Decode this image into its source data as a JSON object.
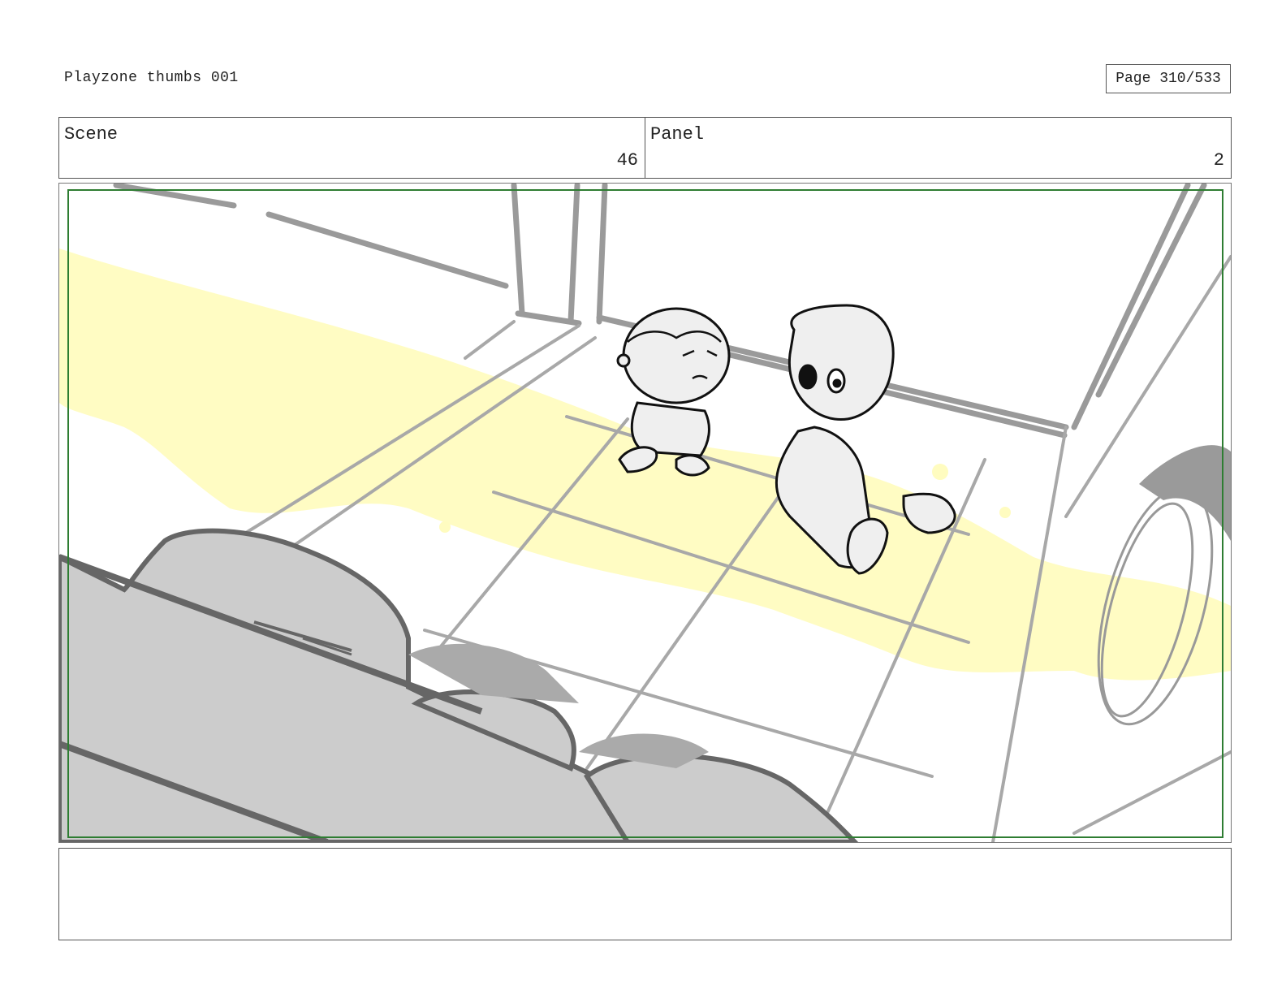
{
  "header": {
    "title": "Playzone thumbs 001",
    "page_label": "Page 310/533"
  },
  "fields": {
    "scene_label": "Scene",
    "scene_value": "46",
    "panel_label": "Panel",
    "panel_value": "2"
  },
  "colors": {
    "safe_frame": "#2e7d32",
    "highlight": "#fffcc0",
    "sketch_gray": "#9a9a9a",
    "fill_gray": "#cccccc"
  },
  "notes": ""
}
